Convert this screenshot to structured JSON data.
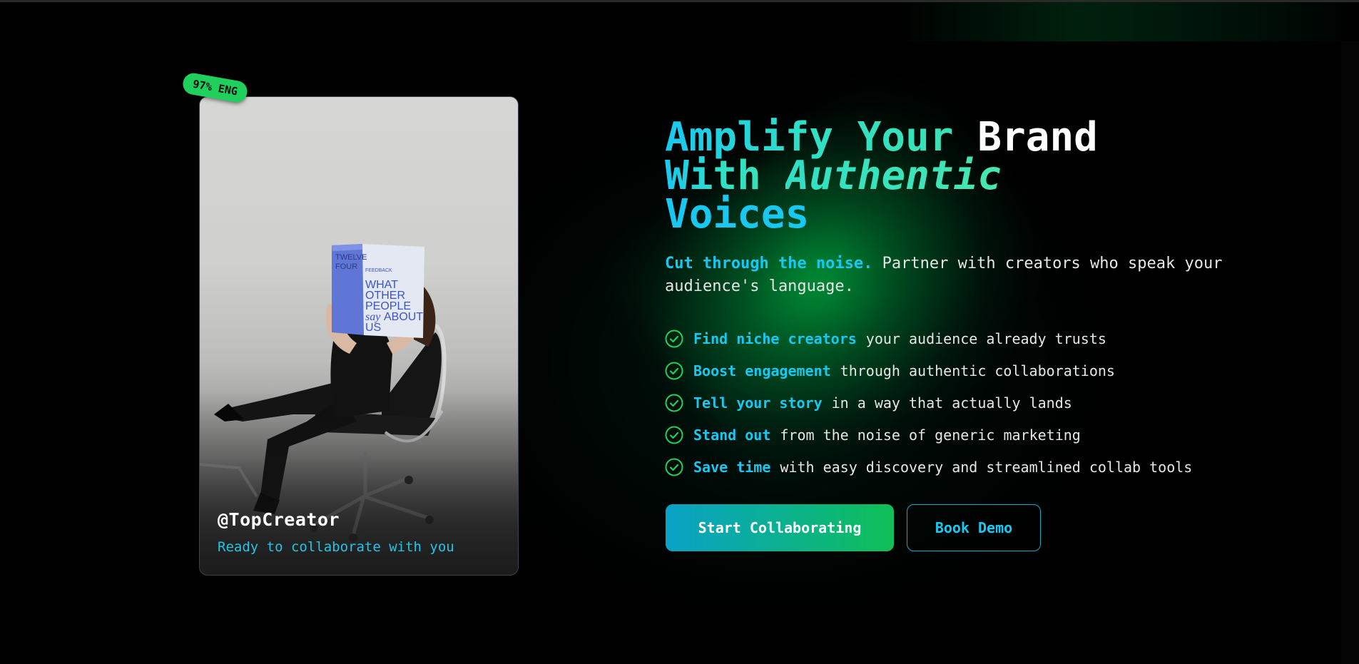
{
  "card": {
    "badge": "97% ENG",
    "handle": "@TopCreator",
    "subtitle": "Ready to collaborate with you",
    "photo_magazine": {
      "spine": "TWELVE FOUR",
      "tag": "FEEDBACK",
      "line1": "WHAT",
      "line2": "OTHER",
      "line3": "PEOPLE",
      "line4_italic": "say",
      "line4": "ABOUT",
      "line5": "US"
    }
  },
  "hero": {
    "headline": {
      "part1": "Amplify Your ",
      "part2": "Brand",
      "part3": "With ",
      "part4": "Authentic",
      "part5": "Voices"
    },
    "lead_strong": "Cut through the noise.",
    "lead_rest": " Partner with creators who speak your audience's language.",
    "features": [
      {
        "strong": "Find niche creators",
        "text": "your audience already trusts"
      },
      {
        "strong": "Boost engagement",
        "text": "through authentic collaborations"
      },
      {
        "strong": "Tell your story",
        "text": "in a way that actually lands"
      },
      {
        "strong": "Stand out",
        "text": "from the noise of generic marketing"
      },
      {
        "strong": "Save time",
        "text": "with easy discovery and streamlined collab tools"
      }
    ],
    "cta_primary": "Start Collaborating",
    "cta_secondary": "Book Demo"
  },
  "colors": {
    "accent_cyan": "#19c8f0",
    "accent_green": "#1fd05c",
    "background": "#000000"
  },
  "icons": {
    "feature": "check-circle-icon"
  }
}
